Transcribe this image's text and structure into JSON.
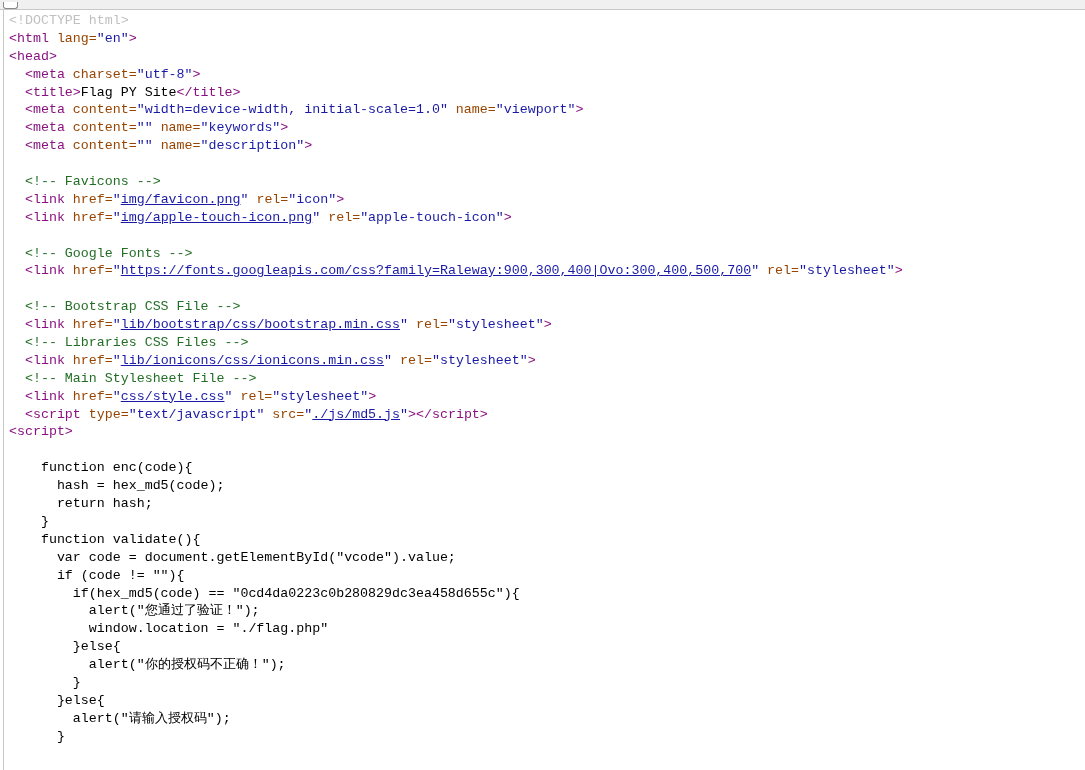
{
  "lines": [
    {
      "kind": "code",
      "tokens": [
        {
          "kind": "doctype",
          "text": "<!DOCTYPE html>"
        }
      ]
    },
    {
      "kind": "code",
      "tokens": [
        {
          "kind": "tag",
          "text": "<html"
        },
        {
          "kind": "attr",
          "text": " lang="
        },
        {
          "kind": "value",
          "text": "\"en\""
        },
        {
          "kind": "tag",
          "text": ">"
        }
      ]
    },
    {
      "kind": "code",
      "tokens": [
        {
          "kind": "tag",
          "text": "<head>"
        }
      ]
    },
    {
      "kind": "code",
      "tokens": [
        {
          "kind": "tag",
          "text": "  <meta"
        },
        {
          "kind": "attr",
          "text": " charset="
        },
        {
          "kind": "value",
          "text": "\"utf-8\""
        },
        {
          "kind": "tag",
          "text": ">"
        }
      ]
    },
    {
      "kind": "code",
      "tokens": [
        {
          "kind": "tag",
          "text": "  <title>"
        },
        {
          "kind": "text",
          "text": "Flag PY Site"
        },
        {
          "kind": "tag",
          "text": "</title>"
        }
      ]
    },
    {
      "kind": "code",
      "tokens": [
        {
          "kind": "tag",
          "text": "  <meta"
        },
        {
          "kind": "attr",
          "text": " content="
        },
        {
          "kind": "value",
          "text": "\"width=device-width, initial-scale=1.0\""
        },
        {
          "kind": "attr",
          "text": " name="
        },
        {
          "kind": "value",
          "text": "\"viewport\""
        },
        {
          "kind": "tag",
          "text": ">"
        }
      ]
    },
    {
      "kind": "code",
      "tokens": [
        {
          "kind": "tag",
          "text": "  <meta"
        },
        {
          "kind": "attr",
          "text": " content="
        },
        {
          "kind": "value",
          "text": "\"\""
        },
        {
          "kind": "attr",
          "text": " name="
        },
        {
          "kind": "value",
          "text": "\"keywords\""
        },
        {
          "kind": "tag",
          "text": ">"
        }
      ]
    },
    {
      "kind": "code",
      "tokens": [
        {
          "kind": "tag",
          "text": "  <meta"
        },
        {
          "kind": "attr",
          "text": " content="
        },
        {
          "kind": "value",
          "text": "\"\""
        },
        {
          "kind": "attr",
          "text": " name="
        },
        {
          "kind": "value",
          "text": "\"description\""
        },
        {
          "kind": "tag",
          "text": ">"
        }
      ]
    },
    {
      "kind": "blank"
    },
    {
      "kind": "code",
      "tokens": [
        {
          "kind": "comment",
          "text": "  <!-- Favicons -->"
        }
      ]
    },
    {
      "kind": "code",
      "tokens": [
        {
          "kind": "tag",
          "text": "  <link"
        },
        {
          "kind": "attr",
          "text": " href="
        },
        {
          "kind": "value",
          "text": "\""
        },
        {
          "kind": "link",
          "text": "img/favicon.png"
        },
        {
          "kind": "value",
          "text": "\""
        },
        {
          "kind": "attr",
          "text": " rel="
        },
        {
          "kind": "value",
          "text": "\"icon\""
        },
        {
          "kind": "tag",
          "text": ">"
        }
      ]
    },
    {
      "kind": "code",
      "tokens": [
        {
          "kind": "tag",
          "text": "  <link"
        },
        {
          "kind": "attr",
          "text": " href="
        },
        {
          "kind": "value",
          "text": "\""
        },
        {
          "kind": "link",
          "text": "img/apple-touch-icon.png"
        },
        {
          "kind": "value",
          "text": "\""
        },
        {
          "kind": "attr",
          "text": " rel="
        },
        {
          "kind": "value",
          "text": "\"apple-touch-icon\""
        },
        {
          "kind": "tag",
          "text": ">"
        }
      ]
    },
    {
      "kind": "blank"
    },
    {
      "kind": "code",
      "tokens": [
        {
          "kind": "comment",
          "text": "  <!-- Google Fonts -->"
        }
      ]
    },
    {
      "kind": "code",
      "tokens": [
        {
          "kind": "tag",
          "text": "  <link"
        },
        {
          "kind": "attr",
          "text": " href="
        },
        {
          "kind": "value",
          "text": "\""
        },
        {
          "kind": "link",
          "text": "https://fonts.googleapis.com/css?family=Raleway:900,300,400|Ovo:300,400,500,700"
        },
        {
          "kind": "value",
          "text": "\""
        },
        {
          "kind": "attr",
          "text": " rel="
        },
        {
          "kind": "value",
          "text": "\"stylesheet\""
        },
        {
          "kind": "tag",
          "text": ">"
        }
      ]
    },
    {
      "kind": "blank"
    },
    {
      "kind": "code",
      "tokens": [
        {
          "kind": "comment",
          "text": "  <!-- Bootstrap CSS File -->"
        }
      ]
    },
    {
      "kind": "code",
      "tokens": [
        {
          "kind": "tag",
          "text": "  <link"
        },
        {
          "kind": "attr",
          "text": " href="
        },
        {
          "kind": "value",
          "text": "\""
        },
        {
          "kind": "link",
          "text": "lib/bootstrap/css/bootstrap.min.css"
        },
        {
          "kind": "value",
          "text": "\""
        },
        {
          "kind": "attr",
          "text": " rel="
        },
        {
          "kind": "value",
          "text": "\"stylesheet\""
        },
        {
          "kind": "tag",
          "text": ">"
        }
      ]
    },
    {
      "kind": "code",
      "tokens": [
        {
          "kind": "comment",
          "text": "  <!-- Libraries CSS Files -->"
        }
      ]
    },
    {
      "kind": "code",
      "tokens": [
        {
          "kind": "tag",
          "text": "  <link"
        },
        {
          "kind": "attr",
          "text": " href="
        },
        {
          "kind": "value",
          "text": "\""
        },
        {
          "kind": "link",
          "text": "lib/ionicons/css/ionicons.min.css"
        },
        {
          "kind": "value",
          "text": "\""
        },
        {
          "kind": "attr",
          "text": " rel="
        },
        {
          "kind": "value",
          "text": "\"stylesheet\""
        },
        {
          "kind": "tag",
          "text": ">"
        }
      ]
    },
    {
      "kind": "code",
      "tokens": [
        {
          "kind": "comment",
          "text": "  <!-- Main Stylesheet File -->"
        }
      ]
    },
    {
      "kind": "code",
      "tokens": [
        {
          "kind": "tag",
          "text": "  <link"
        },
        {
          "kind": "attr",
          "text": " href="
        },
        {
          "kind": "value",
          "text": "\""
        },
        {
          "kind": "link",
          "text": "css/style.css"
        },
        {
          "kind": "value",
          "text": "\""
        },
        {
          "kind": "attr",
          "text": " rel="
        },
        {
          "kind": "value",
          "text": "\"stylesheet\""
        },
        {
          "kind": "tag",
          "text": ">"
        }
      ]
    },
    {
      "kind": "code",
      "tokens": [
        {
          "kind": "tag",
          "text": "  <script"
        },
        {
          "kind": "attr",
          "text": " type="
        },
        {
          "kind": "value",
          "text": "\"text/javascript\""
        },
        {
          "kind": "attr",
          "text": " src="
        },
        {
          "kind": "value",
          "text": "\""
        },
        {
          "kind": "link",
          "text": "./js/md5.js"
        },
        {
          "kind": "value",
          "text": "\""
        },
        {
          "kind": "tag",
          "text": "></script>"
        }
      ]
    },
    {
      "kind": "code",
      "tokens": [
        {
          "kind": "tag",
          "text": "<script>"
        }
      ]
    },
    {
      "kind": "blank"
    },
    {
      "kind": "code",
      "tokens": [
        {
          "kind": "text",
          "text": "    function enc(code){"
        }
      ]
    },
    {
      "kind": "code",
      "tokens": [
        {
          "kind": "text",
          "text": "      hash = hex_md5(code);"
        }
      ]
    },
    {
      "kind": "code",
      "tokens": [
        {
          "kind": "text",
          "text": "      return hash;"
        }
      ]
    },
    {
      "kind": "code",
      "tokens": [
        {
          "kind": "text",
          "text": "    }"
        }
      ]
    },
    {
      "kind": "code",
      "tokens": [
        {
          "kind": "text",
          "text": "    function validate(){"
        }
      ]
    },
    {
      "kind": "code",
      "tokens": [
        {
          "kind": "text",
          "text": "      var code = document.getElementById(\"vcode\").value;"
        }
      ]
    },
    {
      "kind": "code",
      "tokens": [
        {
          "kind": "text",
          "text": "      if (code != \"\"){"
        }
      ]
    },
    {
      "kind": "code",
      "tokens": [
        {
          "kind": "text",
          "text": "        if(hex_md5(code) == \"0cd4da0223c0b280829dc3ea458d655c\"){"
        }
      ]
    },
    {
      "kind": "code",
      "tokens": [
        {
          "kind": "text",
          "text": "          alert(\"您通过了验证！\");"
        }
      ]
    },
    {
      "kind": "code",
      "tokens": [
        {
          "kind": "text",
          "text": "          window.location = \"./flag.php\""
        }
      ]
    },
    {
      "kind": "code",
      "tokens": [
        {
          "kind": "text",
          "text": "        }else{"
        }
      ]
    },
    {
      "kind": "code",
      "tokens": [
        {
          "kind": "text",
          "text": "          alert(\"你的授权码不正确！\");"
        }
      ]
    },
    {
      "kind": "code",
      "tokens": [
        {
          "kind": "text",
          "text": "        }"
        }
      ]
    },
    {
      "kind": "code",
      "tokens": [
        {
          "kind": "text",
          "text": "      }else{"
        }
      ]
    },
    {
      "kind": "code",
      "tokens": [
        {
          "kind": "text",
          "text": "        alert(\"请输入授权码\");"
        }
      ]
    },
    {
      "kind": "code",
      "tokens": [
        {
          "kind": "text",
          "text": "      }"
        }
      ]
    }
  ]
}
